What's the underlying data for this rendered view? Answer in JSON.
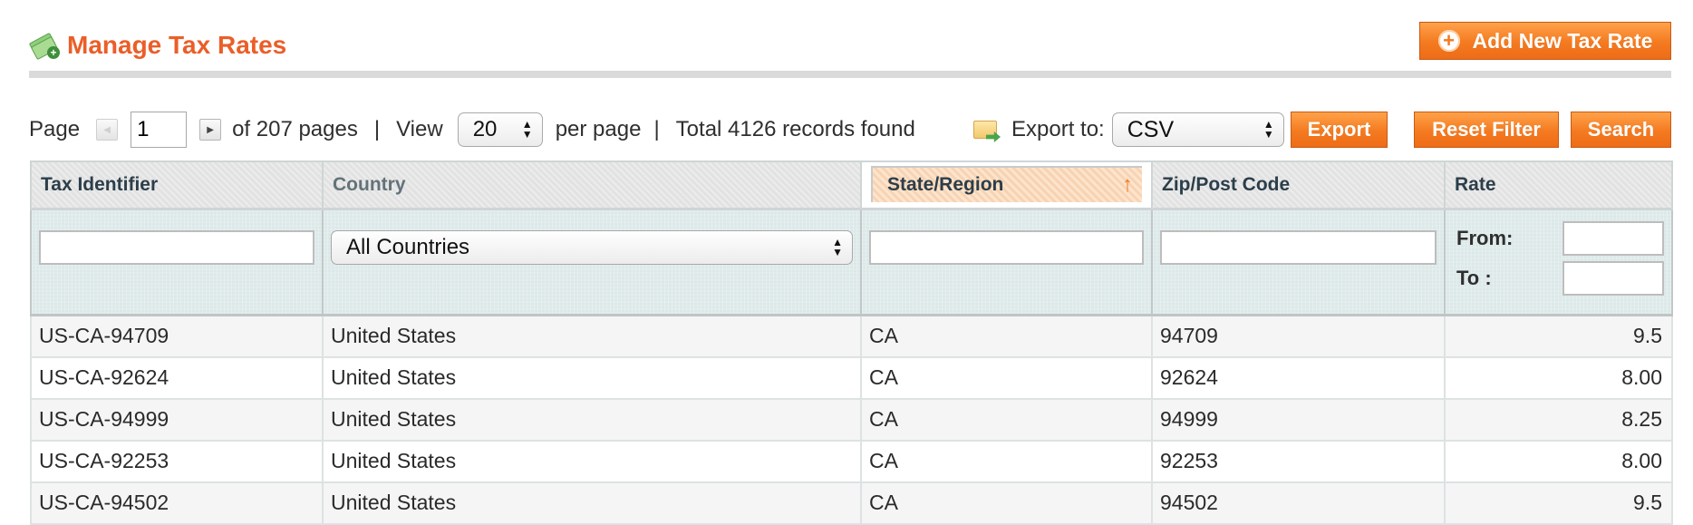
{
  "header": {
    "title": "Manage Tax Rates",
    "icon": "money-add-icon",
    "add_button_label": "Add New Tax Rate"
  },
  "pager": {
    "page_label": "Page",
    "current_page": "1",
    "of_pages_text": "of 207 pages",
    "separator": "|",
    "view_label": "View",
    "per_page_value": "20",
    "per_page_label": "per page",
    "total_text": "Total 4126 records found"
  },
  "export": {
    "label": "Export to:",
    "format_value": "CSV",
    "export_button_label": "Export"
  },
  "actions": {
    "reset_filter_label": "Reset Filter",
    "search_label": "Search"
  },
  "colors": {
    "accent": "#f47a20",
    "title": "#eb5e28",
    "filter_bg": "#dce8e8"
  },
  "grid": {
    "columns": [
      {
        "label": "Tax Identifier"
      },
      {
        "label": "Country"
      },
      {
        "label": "State/Region",
        "sorted": "ascending"
      },
      {
        "label": "Zip/Post Code"
      },
      {
        "label": "Rate"
      }
    ],
    "filters": {
      "tax_identifier": "",
      "country_value": "All Countries",
      "state_region": "",
      "zip_post_code": "",
      "rate_from_label": "From:",
      "rate_from": "",
      "rate_to_label": "To :",
      "rate_to": ""
    },
    "rows": [
      {
        "tax_identifier": "US-CA-94709",
        "country": "United States",
        "state": "CA",
        "zip": "94709",
        "rate": "9.5"
      },
      {
        "tax_identifier": "US-CA-92624",
        "country": "United States",
        "state": "CA",
        "zip": "92624",
        "rate": "8.00"
      },
      {
        "tax_identifier": "US-CA-94999",
        "country": "United States",
        "state": "CA",
        "zip": "94999",
        "rate": "8.25"
      },
      {
        "tax_identifier": "US-CA-92253",
        "country": "United States",
        "state": "CA",
        "zip": "92253",
        "rate": "8.00"
      },
      {
        "tax_identifier": "US-CA-94502",
        "country": "United States",
        "state": "CA",
        "zip": "94502",
        "rate": "9.5"
      }
    ]
  }
}
